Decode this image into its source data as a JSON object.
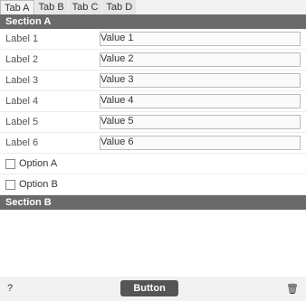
{
  "tabs": [
    "Tab A",
    "Tab B",
    "Tab C",
    "Tab D"
  ],
  "section_a": "Section A",
  "fields": [
    {
      "label": "Label 1",
      "value": "Value 1"
    },
    {
      "label": "Label 2",
      "value": "Value 2"
    },
    {
      "label": "Label 3",
      "value": "Value 3"
    },
    {
      "label": "Label 4",
      "value": "Value 4"
    },
    {
      "label": "Label 5",
      "value": "Value 5"
    },
    {
      "label": "Label 6",
      "value": "Value 6"
    }
  ],
  "option_a": "Option A",
  "option_b": "Option B",
  "section_b": "Section B",
  "primary_button": "Button"
}
